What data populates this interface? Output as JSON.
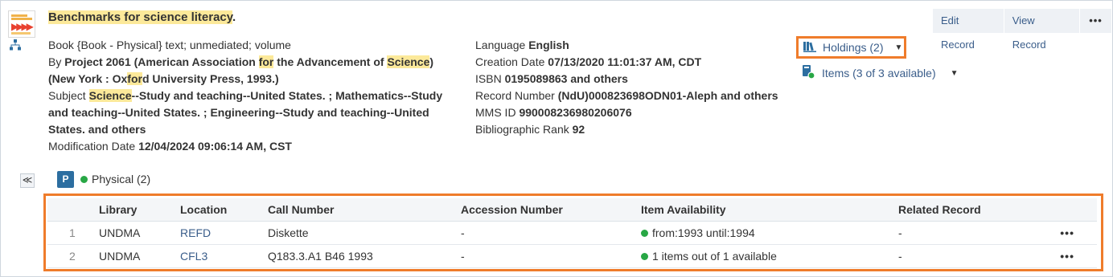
{
  "record": {
    "title_parts": [
      "Benchmarks for science literacy",
      "."
    ],
    "col1": {
      "type_line": "Book {Book - Physical} text; unmediated; volume",
      "by_label": "By",
      "by_parts": [
        "Project 2061 (American Association ",
        "for",
        " the Advancement of ",
        "Science",
        ") (New York : Ox",
        "for",
        "d University Press, 1993.)"
      ],
      "subject_label": "Subject",
      "subject_parts": [
        "Science",
        "--Study and teaching--United States. ; Mathematics--Study and teaching--United States. ; Engineering--Study and teaching--United States. and others"
      ],
      "mod_label": "Modification Date",
      "mod_value": "12/04/2024 09:06:14 AM, CST"
    },
    "col2": {
      "language_label": "Language",
      "language_value": "English",
      "creation_label": "Creation Date",
      "creation_value": "07/13/2020 11:01:37 AM, CDT",
      "isbn_label": "ISBN",
      "isbn_value": "0195089863 and others",
      "recnum_label": "Record Number",
      "recnum_value": "(NdU)000823698ODN01-Aleph and others",
      "mms_label": "MMS ID",
      "mms_value": "990008236980206076",
      "rank_label": "Bibliographic Rank",
      "rank_value": "92"
    }
  },
  "actions": {
    "edit_label": "Edit Record",
    "view_label": "View Record",
    "more_label": "•••"
  },
  "holdings": {
    "label": "Holdings (2)",
    "caret": "▼"
  },
  "items": {
    "label": "Items (3 of 3 available)",
    "caret": "▼"
  },
  "physical": {
    "badge": "P",
    "label": "Physical (2)",
    "collapse_glyph": "≪"
  },
  "table": {
    "headers": [
      "Library",
      "Location",
      "Call Number",
      "Accession Number",
      "Item Availability",
      "Related Record"
    ],
    "rows": [
      {
        "num": "1",
        "library": "UNDMA",
        "location": "REFD",
        "call_number": "Diskette",
        "accession": "-",
        "availability": "from:1993 until:1994",
        "related": "-",
        "more": "•••"
      },
      {
        "num": "2",
        "library": "UNDMA",
        "location": "CFL3",
        "call_number": "Q183.3.A1 B46 1993",
        "accession": "-",
        "availability": "1 items out of 1 available",
        "related": "-",
        "more": "•••"
      }
    ]
  },
  "colors": {
    "highlight": "#fce99a",
    "link": "#3a5d8a",
    "focus_border": "#ef7c2b",
    "available": "#28a745",
    "badge": "#2c6ea0"
  }
}
